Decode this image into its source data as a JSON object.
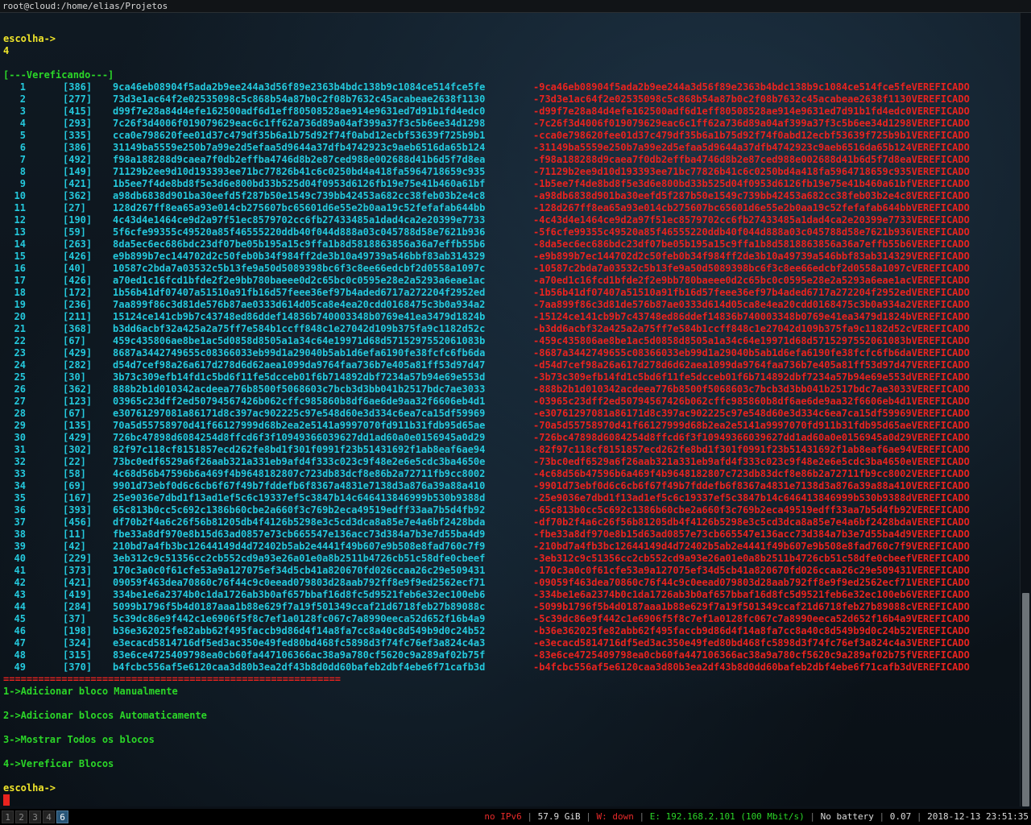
{
  "window": {
    "title": "root@cloud:/home/elias/Projetos"
  },
  "terminal": {
    "prompt_label": "escolha->",
    "input_value": "4",
    "verifying_header": "[---Vereficando---]",
    "verified_suffix": "VEREFICADO",
    "separator": "==========================================================",
    "menu": [
      "1->Adicionar bloco Manualmente",
      "2->Adicionar blocos Automaticamente",
      "3->Mostrar Todos os blocos",
      "4->Vereficar Blocos"
    ],
    "final_prompt": "escolha->",
    "blocks": [
      {
        "n": "1",
        "size": "[386]",
        "hash": "9ca46eb08904f5ada2b9ee244a3d56f89e2363b4bdc138b9c1084ce514fce5fe"
      },
      {
        "n": "2",
        "size": "[277]",
        "hash": "73d3e1ac64f2e02535098c5c868b54a87b0c2f08b7632c45acabeae2638f1130"
      },
      {
        "n": "3",
        "size": "[415]",
        "hash": "d99f7e28a84d4efe162500adf6d1eff80508528ae914e9631ed7d91b1fd4edc0"
      },
      {
        "n": "4",
        "size": "[293]",
        "hash": "7c26f3d4006f019079629eac6c1ff62a736d89a04af399a37f3c5b6ee34d1298"
      },
      {
        "n": "5",
        "size": "[335]",
        "hash": "cca0e798620fee01d37c479df35b6a1b75d92f74f0abd12ecbf53639f725b9b1"
      },
      {
        "n": "6",
        "size": "[386]",
        "hash": "31149ba5559e250b7a99e2d5efaa5d9644a37dfb4742923c9aeb6516da65b124"
      },
      {
        "n": "7",
        "size": "[492]",
        "hash": "f98a188288d9caea7f0db2effba4746d8b2e87ced988e002688d41b6d5f7d8ea"
      },
      {
        "n": "8",
        "size": "[149]",
        "hash": "71129b2ee9d10d193393ee71bc77826b41c6c0250bd4a418fa5964718659c935"
      },
      {
        "n": "9",
        "size": "[421]",
        "hash": "1b5ee7f4de8bd8f5e3d6e800bd33b525d04f0953d6126fb19e75e41b460a61bf"
      },
      {
        "n": "10",
        "size": "[362]",
        "hash": "a98db6838d901ba30eefd5f287b50e1549c739bb42453a682cc38feb03b2e4c8"
      },
      {
        "n": "11",
        "size": "[27]",
        "hash": "128d267ff8ea65a93e014cb275607bc65601d6e55e2b0aa19c52fefafab644bb"
      },
      {
        "n": "12",
        "size": "[190]",
        "hash": "4c43d4e1464ce9d2a97f51ec8579702cc6fb27433485a1dad4ca2e20399e7733"
      },
      {
        "n": "13",
        "size": "[59]",
        "hash": "5f6cfe99355c49520a85f46555220ddb40f044d888a03c045788d58e7621b936"
      },
      {
        "n": "14",
        "size": "[263]",
        "hash": "8da5ec6ec686bdc23df07be05b195a15c9ffa1b8d5818863856a36a7effb55b6"
      },
      {
        "n": "15",
        "size": "[426]",
        "hash": "e9b899b7ec144702d2c50feb0b34f984ff2de3b10a49739a546bbf83ab314329"
      },
      {
        "n": "16",
        "size": "[40]",
        "hash": "10587c2bda7a03532c5b13fe9a50d5089398bc6f3c8ee66edcbf2d0558a1097c"
      },
      {
        "n": "17",
        "size": "[426]",
        "hash": "a70ed1c16fcd1bfde2f2e9bb780baeee0d2c65bc0c0595e28e2a5293a6eae1ac"
      },
      {
        "n": "18",
        "size": "[172]",
        "hash": "1b56b41df07407a51510a91fb16d57feee36ef97b4aded6717a272204f2952ed"
      },
      {
        "n": "19",
        "size": "[236]",
        "hash": "7aa899f86c3d81de576b87ae0333d614d05ca8e4ea20cdd0168475c3b0a934a2"
      },
      {
        "n": "20",
        "size": "[211]",
        "hash": "15124ce141cb9b7c43748ed86ddef14836b740003348b0769e41ea3479d1824b"
      },
      {
        "n": "21",
        "size": "[368]",
        "hash": "b3dd6acbf32a425a2a75ff7e584b1ccff848c1e27042d109b375fa9c1182d52c"
      },
      {
        "n": "22",
        "size": "[67]",
        "hash": "459c435806ae8be1ac5d0858d8505a1a34c64e19971d68d5715297552061083b"
      },
      {
        "n": "23",
        "size": "[429]",
        "hash": "8687a3442749655c08366033eb99d1a29040b5ab1d6efa6190fe38fcfc6fb6da"
      },
      {
        "n": "24",
        "size": "[282]",
        "hash": "d54d7cef98a26a617d278d6d62aea1099da9764faa736b7e405a81ff53d97d47"
      },
      {
        "n": "25",
        "size": "[30]",
        "hash": "3b73c309efb14fd1c5bd6f11fe5dcceb01f6b714892dbf7234a57b94e69e553d"
      },
      {
        "n": "26",
        "size": "[362]",
        "hash": "888b2b1d010342acdeea776b8500f5068603c7bcb3d3bb041b2517bdc7ae3033"
      },
      {
        "n": "27",
        "size": "[123]",
        "hash": "03965c23dff2ed50794567426b062cffc985860b8df6ae6de9aa32f6606eb4d1"
      },
      {
        "n": "28",
        "size": "[67]",
        "hash": "e30761297081a86171d8c397ac902225c97e548d60e3d334c6ea7ca15df59969"
      },
      {
        "n": "29",
        "size": "[135]",
        "hash": "70a5d55758970d41f66127999d68b2ea2e5141a9997070fd911b31fdb95d65ae"
      },
      {
        "n": "30",
        "size": "[429]",
        "hash": "726bc47898d6084254d8ffcd6f3f10949366039627dd1ad60a0e0156945a0d29"
      },
      {
        "n": "31",
        "size": "[302]",
        "hash": "82f97c118cf8151857ecd262fe8bd1f301f0991f23b51431692f1ab8eaf6ae94"
      },
      {
        "n": "32",
        "size": "[22]",
        "hash": "73bc0edf6529a6f26aab321a331eb9afd4f333c023c9f48e2e6e5cdc3ba4650e"
      },
      {
        "n": "33",
        "size": "[58]",
        "hash": "4c68d56b47596b6a469f4b9648182807c723db83dcf8e86b2a72711fb9cc8002"
      },
      {
        "n": "34",
        "size": "[69]",
        "hash": "9901d73ebf0d6c6cb6f67f49b7fddefb6f8367a4831e7138d3a876a39a88a410"
      },
      {
        "n": "35",
        "size": "[167]",
        "hash": "25e9036e7dbd1f13ad1ef5c6c19337ef5c3847b14c646413846999b530b9388d"
      },
      {
        "n": "36",
        "size": "[393]",
        "hash": "65c813b0cc5c692c1386b60cbe2a660f3c769b2eca49519edff33aa7b5d4fb92"
      },
      {
        "n": "37",
        "size": "[456]",
        "hash": "df70b2f4a6c26f56b81205db4f4126b5298e3c5cd3dca8a85e7e4a6bf2428bda"
      },
      {
        "n": "38",
        "size": "[11]",
        "hash": "fbe33a8df970e8b15d63ad0857e73cb665547e136acc73d384a7b3e7d55ba4d9"
      },
      {
        "n": "39",
        "size": "[42]",
        "hash": "210bd7a4fb3bc12644149d4d72402b5ab2e4441f49b607e9b508e8fad760c7f9"
      },
      {
        "n": "40",
        "size": "[229]",
        "hash": "3eb312c9c51356cc2cb552cd9a93e26a01e0a8b2511b4726cb51c58dfe0cbeef"
      },
      {
        "n": "41",
        "size": "[373]",
        "hash": "170c3a0c0f61cfe53a9a127075ef34d5cb41a820670fd026ccaa26c29e509431"
      },
      {
        "n": "42",
        "size": "[421]",
        "hash": "09059f463dea70860c76f44c9c0eead079803d28aab792ff8e9f9ed2562ecf71"
      },
      {
        "n": "43",
        "size": "[419]",
        "hash": "334be1e6a2374b0c1da1726ab3b0af657bbaf16d8fc5d9521feb6e32ec100eb6"
      },
      {
        "n": "44",
        "size": "[284]",
        "hash": "5099b1796f5b4d0187aaa1b88e629f7a19f501349ccaf21d6718feb27b89088c"
      },
      {
        "n": "45",
        "size": "[37]",
        "hash": "5c39dc86e9f442c1e6906f5f8c7ef1a0128fc067c7a8990eeca52d652f16b4a9"
      },
      {
        "n": "46",
        "size": "[198]",
        "hash": "b36e362025fe82abb62f495faccb9d86d4f14a8fa7cc8a40c8d549b9d0c24b52"
      },
      {
        "n": "47",
        "size": "[324]",
        "hash": "e3ecacd5814716df5ed3ac350e49fed80bd468fc5898d3f74fc76ef3a824c4a3"
      },
      {
        "n": "48",
        "size": "[315]",
        "hash": "83e6ce4725409798ea0cb60fa447106366ac38a9a780cf5620c9a289af02b75f"
      },
      {
        "n": "49",
        "size": "[370]",
        "hash": "b4fcbc556af5e6120caa3d80b3ea2df43b8d0dd60bafeb2dbf4ebe6f71cafb3d"
      }
    ]
  },
  "bar": {
    "workspaces": [
      "1",
      "2",
      "3",
      "4",
      "6"
    ],
    "active_workspace": "6",
    "ipv6": "no IPv6",
    "disk": "57.9 GiB",
    "wifi": "W: down",
    "ethernet": "E: 192.168.2.101 (100 Mbit/s)",
    "battery": "No battery",
    "load": "0.07",
    "datetime": "2018-12-13 23:51:35"
  },
  "colors": {
    "prompt": "#f0e52a",
    "menu": "#2bd628",
    "hash": "#24c8dc",
    "verified": "#e8231f",
    "active_workspace": "#285577"
  }
}
